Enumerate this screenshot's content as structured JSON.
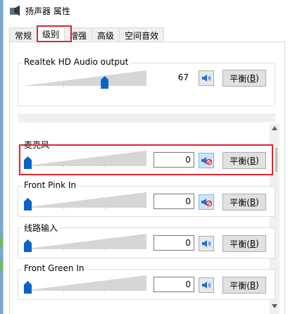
{
  "window": {
    "title": "扬声器 属性"
  },
  "tabs": [
    {
      "label": "常规"
    },
    {
      "label": "级别"
    },
    {
      "label": "增强"
    },
    {
      "label": "高级"
    },
    {
      "label": "空间音效"
    }
  ],
  "output": {
    "name": "Realtek HD Audio output",
    "value": "67",
    "level": 67,
    "balance_label": "平衡(",
    "balance_key": "B",
    "balance_end": ")"
  },
  "inputs": [
    {
      "name": "麦克风",
      "value": "0",
      "level": 0,
      "muted": true
    },
    {
      "name": "Front Pink In",
      "value": "0",
      "level": 0,
      "muted": true
    },
    {
      "name": "线路输入",
      "value": "0",
      "level": 0,
      "muted": false
    },
    {
      "name": "Front Green In",
      "value": "0",
      "level": 0,
      "muted": false
    }
  ],
  "balance": {
    "label": "平衡(",
    "key": "B",
    "end": ")"
  },
  "colors": {
    "highlight": "#d9262f",
    "thumb": "#0a63c9",
    "speaker": "#1e6fcf",
    "mute_badge": "#d9262f"
  }
}
